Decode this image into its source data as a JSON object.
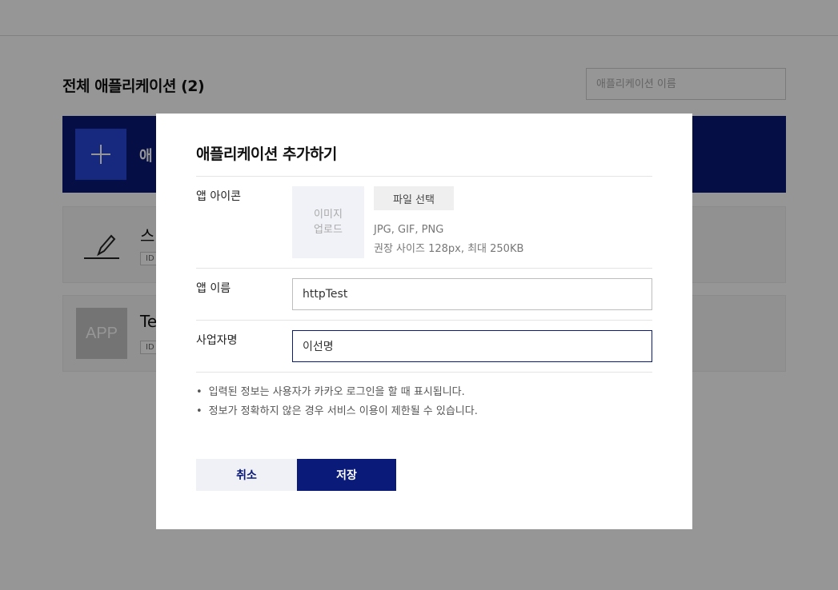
{
  "page": {
    "title": "전체 애플리케이션 (2)",
    "search_placeholder": "애플리케이션 이름",
    "add_card_label": "애",
    "apps": [
      {
        "name": "스",
        "id_label": "ID"
      },
      {
        "name": "Te",
        "id_label": "ID",
        "icon_text": "APP"
      }
    ]
  },
  "modal": {
    "title": "애플리케이션 추가하기",
    "icon_row": {
      "label": "앱 아이콘",
      "upload_text": "이미지 업로드",
      "file_button": "파일 선택",
      "hint_formats": "JPG, GIF, PNG",
      "hint_size": "권장 사이즈 128px, 최대 250KB"
    },
    "name_row": {
      "label": "앱 이름",
      "value": "httpTest"
    },
    "company_row": {
      "label": "사업자명",
      "value": "이선명"
    },
    "notes": [
      "입력된 정보는 사용자가 카카오 로그인을 할 때 표시됩니다.",
      "정보가 정확하지 않은 경우 서비스 이용이 제한될 수 있습니다."
    ],
    "cancel_label": "취소",
    "save_label": "저장"
  },
  "colors": {
    "primary": "#0a1a78",
    "accent": "#2747d6",
    "overlay": "rgba(0,0,0,0.41)"
  }
}
